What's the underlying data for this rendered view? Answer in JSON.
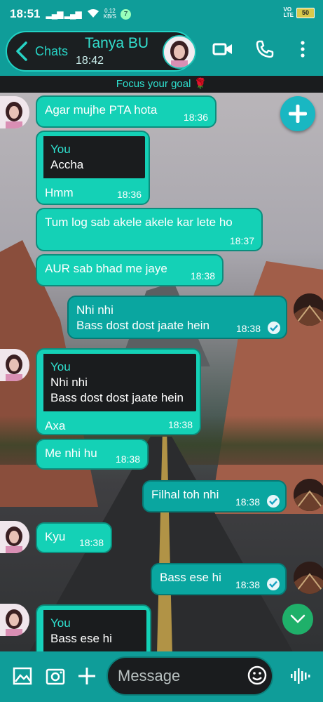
{
  "status_bar": {
    "time": "18:51",
    "network_speed": "0.12\nKB/S",
    "notification_count": "7",
    "volte": "VO\nLTE",
    "battery": "50"
  },
  "header": {
    "back_label": "Chats",
    "contact_name": "Tanya BU",
    "last_seen": "18:42"
  },
  "motto": "Focus your goal 🌹",
  "messages": [
    {
      "dir": "in",
      "text": "Agar mujhe PTA hota",
      "time": "18:36"
    },
    {
      "dir": "in",
      "reply_author": "You",
      "reply_text": "Accha",
      "text": "Hmm",
      "time": "18:36"
    },
    {
      "dir": "in",
      "text": "Tum log sab akele akele kar lete ho",
      "time": "18:37"
    },
    {
      "dir": "in",
      "text": "AUR sab bhad me jaye",
      "time": "18:38"
    },
    {
      "dir": "out",
      "text": "Nhi nhi\nBass dost dost jaate hein",
      "time": "18:38"
    },
    {
      "dir": "in",
      "reply_author": "You",
      "reply_text": "Nhi nhi\nBass dost dost jaate hein",
      "text": "Axa",
      "time": "18:38"
    },
    {
      "dir": "in",
      "text": "Me nhi hu",
      "time": "18:38"
    },
    {
      "dir": "out",
      "text": "Filhal toh nhi",
      "time": "18:38"
    },
    {
      "dir": "in",
      "text": "Kyu",
      "time": "18:38"
    },
    {
      "dir": "out",
      "text": "Bass ese hi",
      "time": "18:38"
    },
    {
      "dir": "in",
      "reply_author": "You",
      "reply_text": "Bass ese hi",
      "text": "",
      "time": ""
    }
  ],
  "composer": {
    "placeholder": "Message"
  },
  "colors": {
    "accent": "#0f9d99",
    "bubble_in": "#14d1b6",
    "bubble_out": "#0aa6a0",
    "dark": "#1a1c1e"
  }
}
